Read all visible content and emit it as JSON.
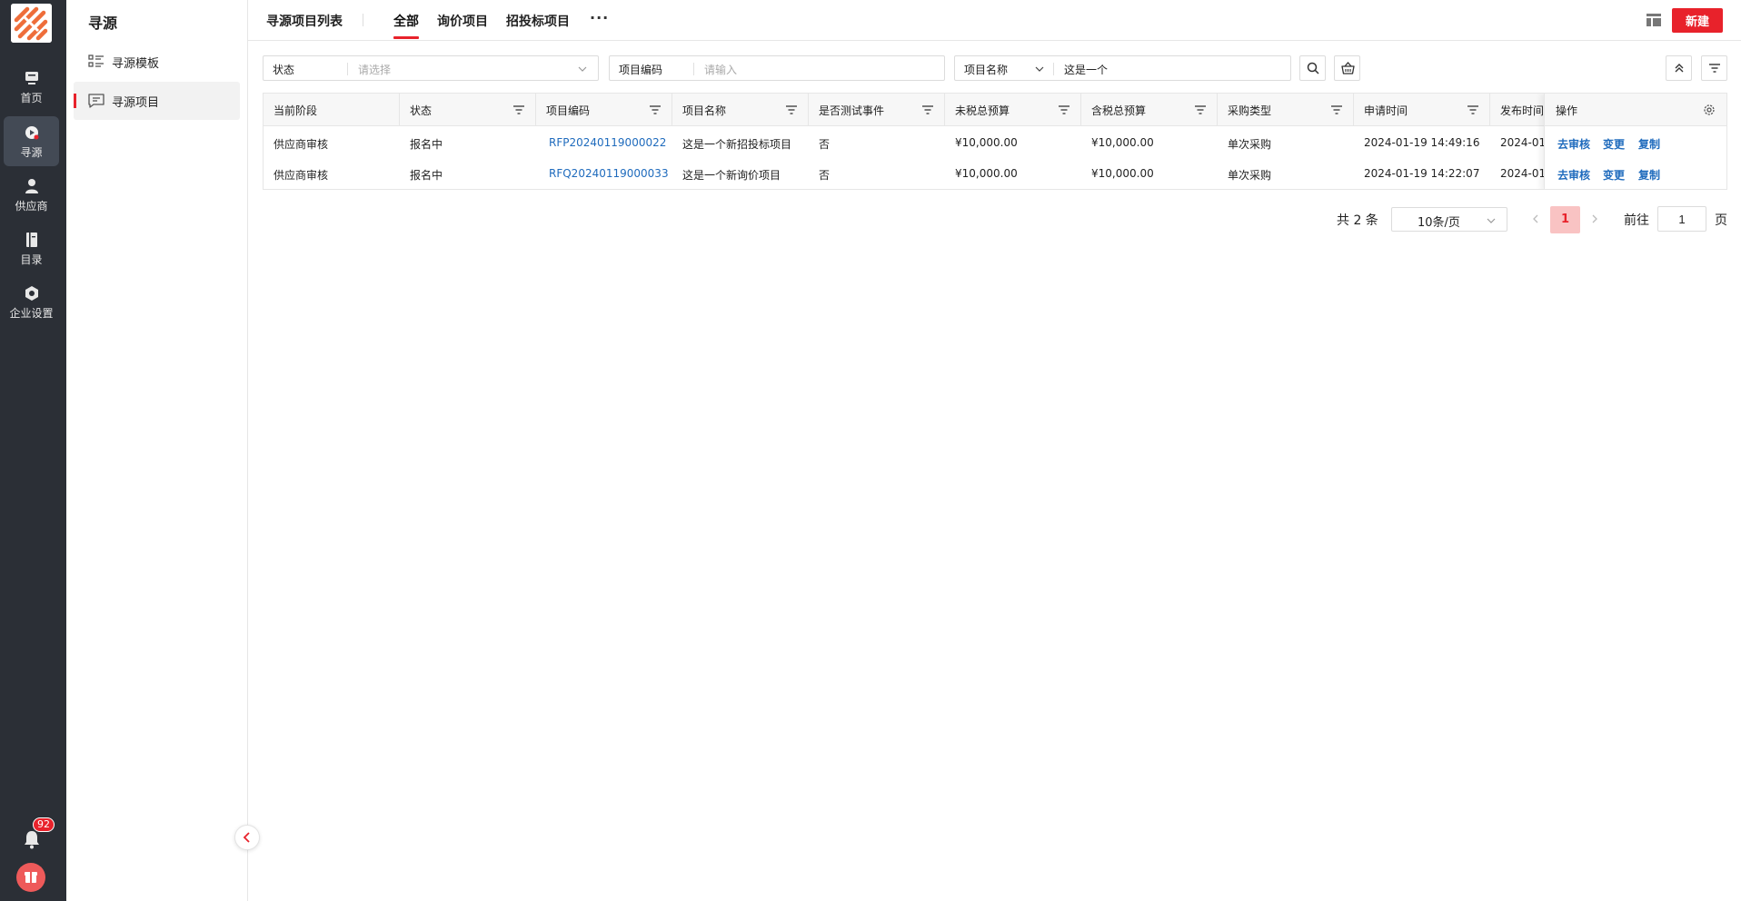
{
  "rail": {
    "items": [
      {
        "label": "首页",
        "icon": "dashboard-icon"
      },
      {
        "label": "寻源",
        "icon": "sourcing-icon"
      },
      {
        "label": "供应商",
        "icon": "supplier-icon"
      },
      {
        "label": "目录",
        "icon": "catalog-icon"
      },
      {
        "label": "企业设置",
        "icon": "settings-icon"
      }
    ],
    "active": "寻源",
    "notification_count": "92"
  },
  "subnav": {
    "title": "寻源",
    "items": [
      {
        "label": "寻源模板",
        "icon": "template-list-icon"
      },
      {
        "label": "寻源项目",
        "icon": "project-chat-icon"
      }
    ],
    "active": "寻源项目"
  },
  "header": {
    "title": "寻源项目列表",
    "tabs": [
      "全部",
      "询价项目",
      "招投标项目"
    ],
    "active_tab": "全部",
    "more": "···",
    "new_button": "新建"
  },
  "filters": {
    "status": {
      "label": "状态",
      "placeholder": "请选择"
    },
    "code": {
      "label": "项目编码",
      "placeholder": "请输入"
    },
    "name": {
      "label": "项目名称",
      "value": "这是一个"
    }
  },
  "table": {
    "columns": [
      "当前阶段",
      "状态",
      "项目编码",
      "项目名称",
      "是否测试事件",
      "未税总预算",
      "含税总预算",
      "采购类型",
      "申请时间",
      "发布时间"
    ],
    "ops_header": "操作",
    "rows": [
      {
        "stage": "供应商审核",
        "status": "报名中",
        "code": "RFP20240119000022",
        "name": "这是一个新招投标项目",
        "is_test": "否",
        "budget_ex_tax": "¥10,000.00",
        "budget_inc_tax": "¥10,000.00",
        "purchase_type": "单次采购",
        "apply_time": "2024-01-19 14:49:16",
        "publish_time": "2024-01-",
        "ops": [
          "去审核",
          "变更",
          "复制"
        ]
      },
      {
        "stage": "供应商审核",
        "status": "报名中",
        "code": "RFQ20240119000033",
        "name": "这是一个新询价项目",
        "is_test": "否",
        "budget_ex_tax": "¥10,000.00",
        "budget_inc_tax": "¥10,000.00",
        "purchase_type": "单次采购",
        "apply_time": "2024-01-19 14:22:07",
        "publish_time": "2024-01-",
        "ops": [
          "去审核",
          "变更",
          "复制"
        ]
      }
    ]
  },
  "pagination": {
    "total": "共 2 条",
    "page_size": "10条/页",
    "current": "1",
    "goto_label": "前往",
    "goto_value": "1",
    "page_suffix": "页"
  },
  "colors": {
    "accent": "#e8222b",
    "rail_bg": "#2b2f36",
    "link": "#1f6bbd"
  }
}
